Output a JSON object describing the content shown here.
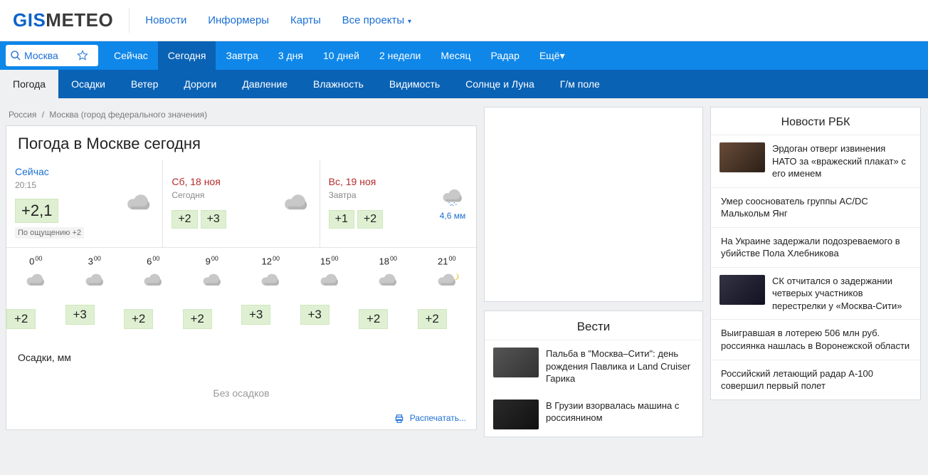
{
  "top": {
    "logo_gis": "GIS",
    "logo_meteo": "METEO",
    "nav": [
      "Новости",
      "Информеры",
      "Карты",
      "Все проекты"
    ]
  },
  "search": {
    "value": "Москва"
  },
  "nav1": {
    "items": [
      "Сейчас",
      "Сегодня",
      "Завтра",
      "3 дня",
      "10 дней",
      "2 недели",
      "Месяц",
      "Радар",
      "Ещё"
    ],
    "active": "Сегодня"
  },
  "nav2": {
    "items": [
      "Погода",
      "Осадки",
      "Ветер",
      "Дороги",
      "Давление",
      "Влажность",
      "Видимость",
      "Солнце и Луна",
      "Г/м поле"
    ],
    "active": "Погода"
  },
  "breadcrumb": {
    "a": "Россия",
    "b": "Москва (город федерального значения)"
  },
  "title": "Погода в Москве сегодня",
  "summary": {
    "now": {
      "label": "Сейчас",
      "time": "20:15",
      "temp": "+2,1",
      "feel": "По ощущению +2"
    },
    "sat": {
      "label": "Сб, 18 ноя",
      "sub": "Сегодня",
      "t1": "+2",
      "t2": "+3"
    },
    "sun": {
      "label": "Вс, 19 ноя",
      "sub": "Завтра",
      "t1": "+1",
      "t2": "+2",
      "precip": "4,6 мм"
    }
  },
  "hourly": {
    "hours": [
      "0",
      "3",
      "6",
      "9",
      "12",
      "15",
      "18",
      "21"
    ],
    "sup": "00",
    "temps": [
      "+2",
      "+3",
      "+2",
      "+2",
      "+3",
      "+3",
      "+2",
      "+2"
    ]
  },
  "precip": {
    "title": "Осадки, мм",
    "none": "Без осадков"
  },
  "print": "Распечатать...",
  "vesti": {
    "title": "Вести",
    "items": [
      "Пальба в \"Москва–Сити\": день рождения Павлика и Land Cruiser Гарика",
      "В Грузии взорвалась машина с россиянином"
    ]
  },
  "rbk": {
    "title": "Новости РБК",
    "items": [
      {
        "thumb": true,
        "t": "Эрдоган отверг извинения НАТО за «вражеский плакат» с его именем"
      },
      {
        "thumb": false,
        "t": "Умер сооснователь группы AC/DC Малькольм Янг"
      },
      {
        "thumb": false,
        "t": "На Украине задержали подозреваемого в убийстве Пола Хлебникова"
      },
      {
        "thumb": true,
        "t": "СК отчитался о задержании четверых участников перестрелки у «Москва-Сити»"
      },
      {
        "thumb": false,
        "t": "Выигравшая в лотерею 506 млн руб. россиянка нашлась в Воронежской области"
      },
      {
        "thumb": false,
        "t": "Российский летающий радар А-100 совершил первый полет"
      }
    ]
  },
  "chart_data": {
    "type": "bar",
    "title": "Hourly temperature today, °C",
    "categories": [
      "0",
      "3",
      "6",
      "9",
      "12",
      "15",
      "18",
      "21"
    ],
    "values": [
      2,
      3,
      2,
      2,
      3,
      3,
      2,
      2
    ],
    "ylim": [
      0,
      4
    ],
    "xlabel": "",
    "ylabel": ""
  }
}
